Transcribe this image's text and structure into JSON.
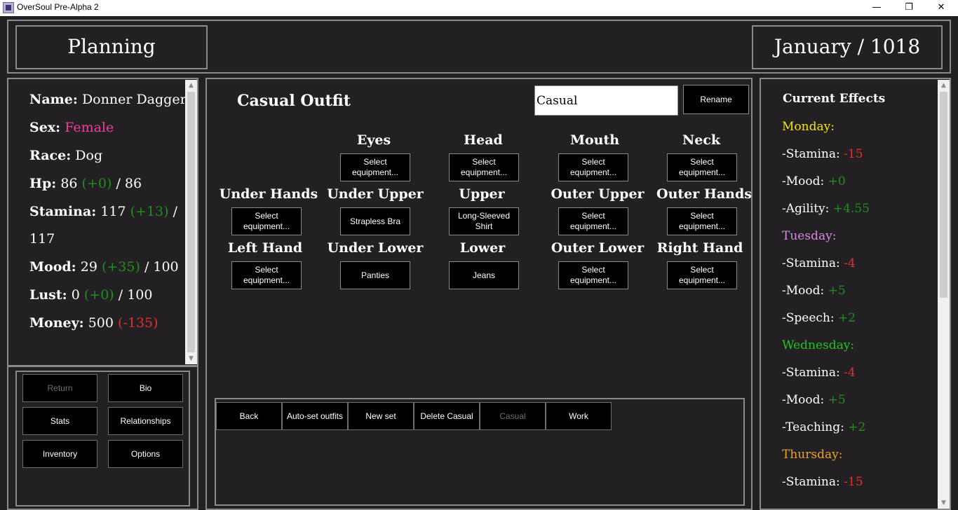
{
  "window": {
    "title": "OverSoul Pre-Alpha 2",
    "minimize": "—",
    "restore": "❐",
    "close": "✕"
  },
  "header": {
    "left_title": "Planning",
    "right_title": "January / 1018"
  },
  "character": {
    "name_label": "Name:",
    "name": "Donner Dagger",
    "sex_label": "Sex:",
    "sex": "Female",
    "race_label": "Race:",
    "race": "Dog",
    "hp_label": "Hp:",
    "hp": "86",
    "hp_delta": "(+0)",
    "hp_max": "/ 86",
    "stamina_label": "Stamina:",
    "stamina": "117",
    "stamina_delta": "(+13)",
    "stamina_slash": "/",
    "stamina_max": "117",
    "mood_label": "Mood:",
    "mood": "29",
    "mood_delta": "(+35)",
    "mood_max": "/ 100",
    "lust_label": "Lust:",
    "lust": "0",
    "lust_delta": "(+0)",
    "lust_max": "/ 100",
    "money_label": "Money:",
    "money": "500",
    "money_delta": "(-135)"
  },
  "nav": {
    "return": "Return",
    "bio": "Bio",
    "stats": "Stats",
    "relationships": "Relationships",
    "inventory": "Inventory",
    "options": "Options"
  },
  "outfit": {
    "title": "Casual Outfit",
    "name_value": "Casual",
    "rename": "Rename",
    "slots": {
      "eyes": {
        "label": "Eyes",
        "value": "Select equipment..."
      },
      "head": {
        "label": "Head",
        "value": "Select equipment..."
      },
      "mouth": {
        "label": "Mouth",
        "value": "Select equipment..."
      },
      "neck": {
        "label": "Neck",
        "value": "Select equipment..."
      },
      "under_hands": {
        "label": "Under Hands",
        "value": "Select equipment..."
      },
      "under_upper": {
        "label": "Under Upper",
        "value": "Strapless Bra"
      },
      "upper": {
        "label": "Upper",
        "value": "Long-Sleeved Shirt"
      },
      "outer_upper": {
        "label": "Outer Upper",
        "value": "Select equipment..."
      },
      "outer_hands": {
        "label": "Outer Hands",
        "value": "Select equipment..."
      },
      "left_hand": {
        "label": "Left Hand",
        "value": "Select equipment..."
      },
      "under_lower": {
        "label": "Under Lower",
        "value": "Panties"
      },
      "lower": {
        "label": "Lower",
        "value": "Jeans"
      },
      "outer_lower": {
        "label": "Outer Lower",
        "value": "Select equipment..."
      },
      "right_hand": {
        "label": "Right Hand",
        "value": "Select equipment..."
      }
    }
  },
  "toolbar": {
    "back": "Back",
    "auto_set": "Auto-set outfits",
    "new_set": "New set",
    "delete": "Delete Casual",
    "casual": "Casual",
    "work": "Work"
  },
  "effects": {
    "title": "Current Effects",
    "days": [
      {
        "day": "Monday:",
        "color": "#f2e600",
        "items": [
          {
            "label": "-Stamina:",
            "value": "-15",
            "tone": "red"
          },
          {
            "label": "-Mood:",
            "value": "+0",
            "tone": "green"
          },
          {
            "label": "-Agility:",
            "value": "+4.55",
            "tone": "green"
          }
        ]
      },
      {
        "day": "Tuesday:",
        "color": "#d98be0",
        "items": [
          {
            "label": "-Stamina:",
            "value": "-4",
            "tone": "red"
          },
          {
            "label": "-Mood:",
            "value": "+5",
            "tone": "green"
          },
          {
            "label": "-Speech:",
            "value": "+2",
            "tone": "green"
          }
        ]
      },
      {
        "day": "Wednesday:",
        "color": "#22c222",
        "items": [
          {
            "label": "-Stamina:",
            "value": "-4",
            "tone": "red"
          },
          {
            "label": "-Mood:",
            "value": "+5",
            "tone": "green"
          },
          {
            "label": "-Teaching:",
            "value": "+2",
            "tone": "green"
          }
        ]
      },
      {
        "day": "Thursday:",
        "color": "#f2a024",
        "items": [
          {
            "label": "-Stamina:",
            "value": "-15",
            "tone": "red"
          }
        ]
      }
    ]
  }
}
